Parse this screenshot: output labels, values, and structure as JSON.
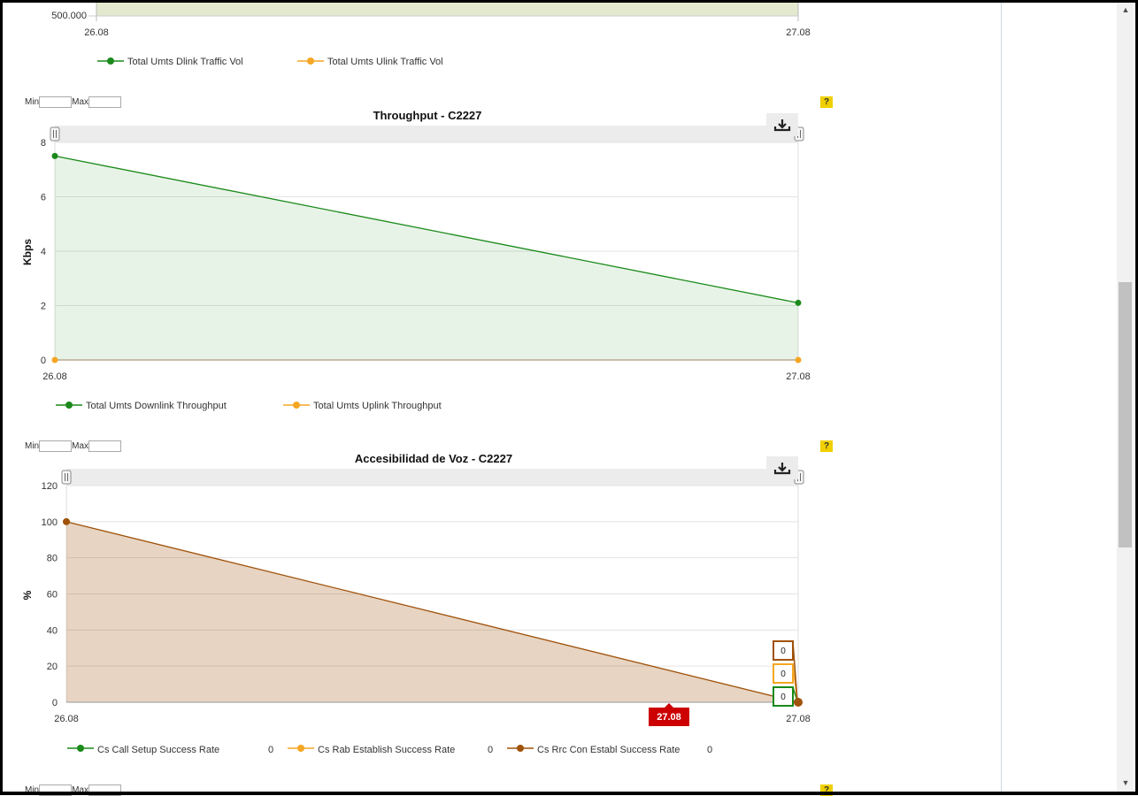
{
  "top_chart": {
    "y_tick": "500.000",
    "x_labels": [
      "26.08",
      "27.08"
    ],
    "legend": [
      {
        "label": "Total Umts Dlink Traffic Vol",
        "color": "#1a8a1a"
      },
      {
        "label": "Total Umts Ulink Traffic Vol",
        "color": "#f5a623"
      }
    ]
  },
  "minmax": {
    "min_label": "Min",
    "max_label": "Max"
  },
  "help_label": "?",
  "chart_data": [
    {
      "type": "area",
      "title": "Throughput - C2227",
      "ylabel": "Kbps",
      "x": [
        "26.08",
        "27.08"
      ],
      "yticks": [
        "0",
        "2",
        "4",
        "6",
        "8"
      ],
      "ylim": [
        0,
        8
      ],
      "series": [
        {
          "name": "Total Umts Downlink Throughput",
          "values": [
            7.5,
            2.1
          ],
          "color": "#1a8a1a"
        },
        {
          "name": "Total Umts Uplink Throughput",
          "values": [
            0,
            0
          ],
          "color": "#f5a623"
        }
      ]
    },
    {
      "type": "area",
      "title": "Accesibilidad de Voz - C2227",
      "ylabel": "%",
      "x": [
        "26.08",
        "27.08"
      ],
      "yticks": [
        "0",
        "20",
        "40",
        "60",
        "80",
        "100",
        "120"
      ],
      "ylim": [
        0,
        120
      ],
      "series": [
        {
          "name": "Cs Call Setup Success Rate",
          "values": [
            null,
            0
          ],
          "color": "#1a8a1a",
          "legend_value": "0"
        },
        {
          "name": "Cs Rab Establish Success Rate",
          "values": [
            null,
            0
          ],
          "color": "#f5a623",
          "legend_value": "0"
        },
        {
          "name": "Cs Rrc Con Establ Success Rate",
          "values": [
            100,
            0
          ],
          "color": "#a0520a",
          "legend_value": "0"
        }
      ],
      "tooltip_values": [
        "0",
        "0",
        "0"
      ],
      "crosshair_label": "27.08"
    }
  ]
}
